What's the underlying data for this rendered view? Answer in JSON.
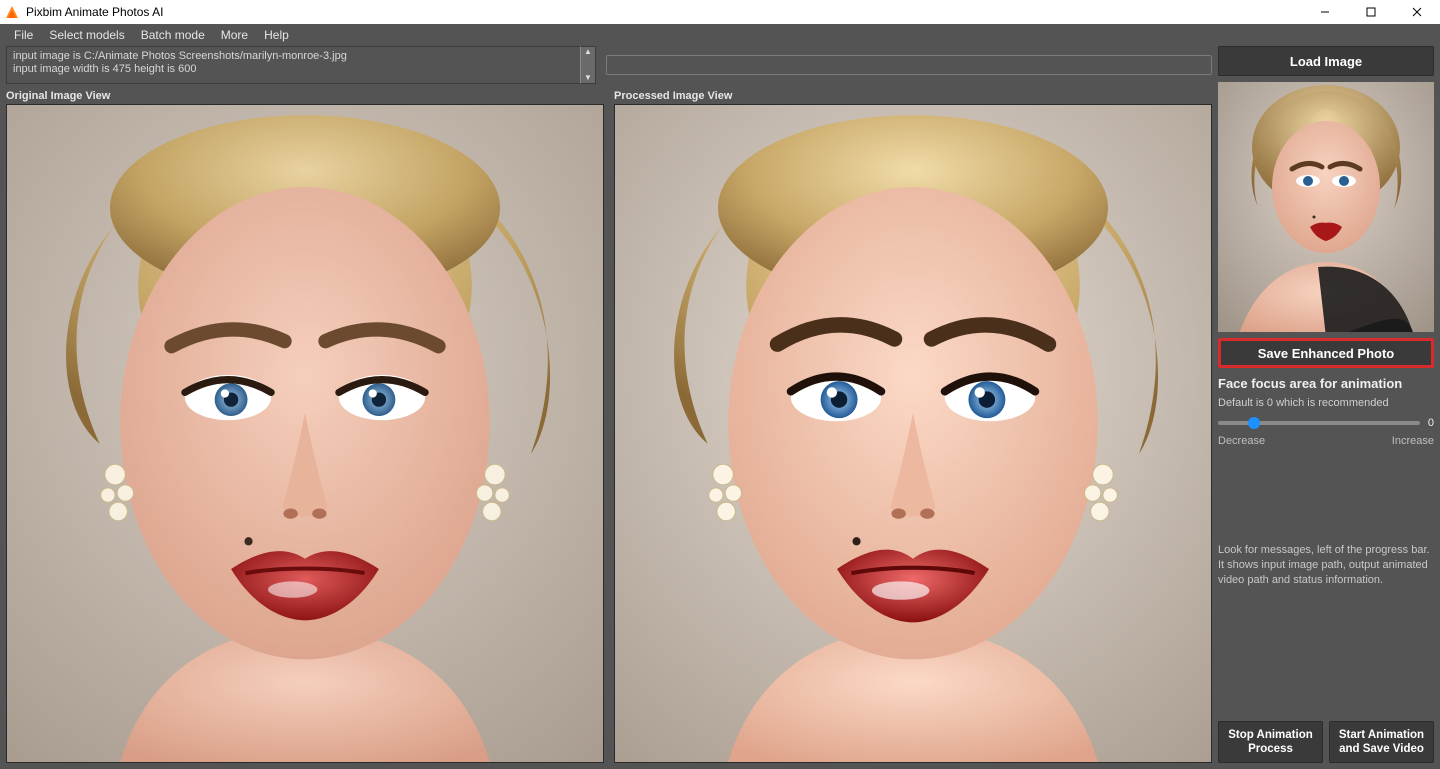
{
  "window": {
    "title": "Pixbim Animate Photos AI"
  },
  "menu": {
    "items": [
      "File",
      "Select models",
      "Batch mode",
      "More",
      "Help"
    ]
  },
  "log": {
    "line1": "input image is C:/Animate  Photos Screenshots/marilyn-monroe-3.jpg",
    "line2": "input image width is 475 height is 600"
  },
  "panes": {
    "original_label": "Original Image View",
    "processed_label": "Processed Image View"
  },
  "sidebar": {
    "load_btn": "Load Image",
    "save_btn": "Save Enhanced Photo",
    "section_title": "Face focus area for animation",
    "section_sub": "Default is 0 which is recommended",
    "slider_value": "0",
    "decrease": "Decrease",
    "increase": "Increase",
    "hint": "Look for messages, left of the progress bar. It shows input image path, output animated video path and status information.",
    "stop_btn": "Stop Animation Process",
    "start_btn": "Start Animation and Save Video"
  },
  "colors": {
    "highlight": "#d92b2b",
    "accent": "#1e90ff"
  },
  "slider": {
    "percent": 18
  }
}
